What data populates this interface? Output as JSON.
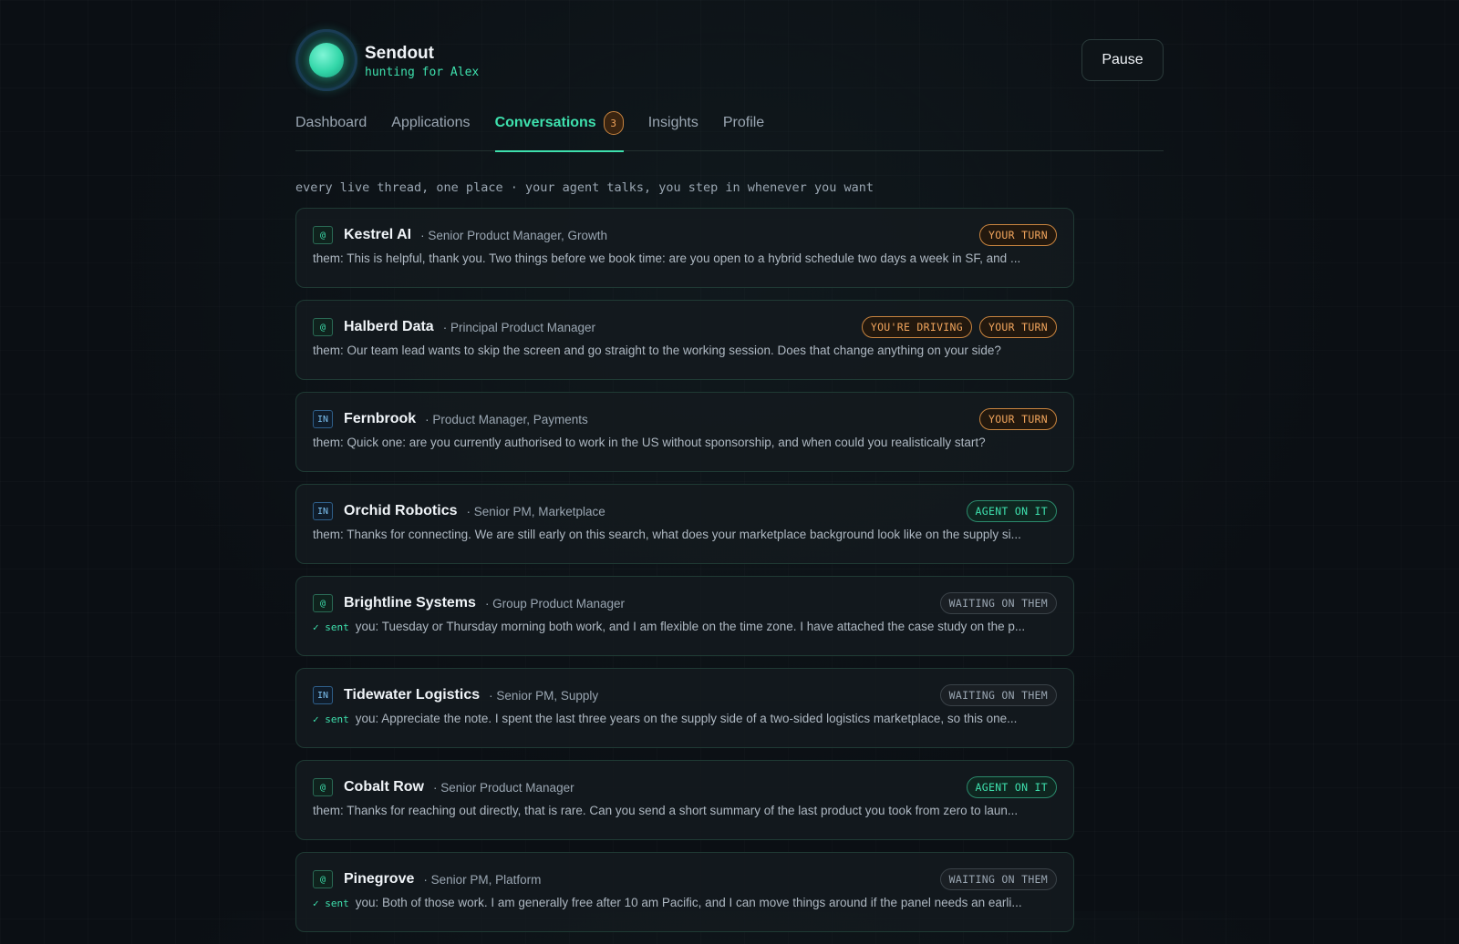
{
  "brand": {
    "name": "Sendout",
    "subtitle": "hunting for Alex"
  },
  "header": {
    "pause_label": "Pause"
  },
  "tabs": [
    {
      "label": "Dashboard"
    },
    {
      "label": "Applications"
    },
    {
      "label": "Conversations",
      "badge": "3",
      "active": true
    },
    {
      "label": "Insights"
    },
    {
      "label": "Profile"
    }
  ],
  "tagline": "every live thread, one place · your agent talks, you step in whenever you want",
  "conversations": [
    {
      "source": "@",
      "company": "Kestrel AI",
      "role": "· Senior Product Manager, Growth",
      "badges": [
        {
          "text": "YOUR TURN",
          "type": "yourturn"
        }
      ],
      "sent": "",
      "message": "them: This is helpful, thank you. Two things before we book time: are you open to a hybrid schedule two days a week in SF, and ..."
    },
    {
      "source": "@",
      "company": "Halberd Data",
      "role": "· Principal Product Manager",
      "badges": [
        {
          "text": "YOU'RE DRIVING",
          "type": "driving"
        },
        {
          "text": "YOUR TURN",
          "type": "yourturn"
        }
      ],
      "sent": "",
      "message": "them: Our team lead wants to skip the screen and go straight to the working session. Does that change anything on your side?"
    },
    {
      "source": "IN",
      "company": "Fernbrook",
      "role": "· Product Manager, Payments",
      "badges": [
        {
          "text": "YOUR TURN",
          "type": "yourturn"
        }
      ],
      "sent": "",
      "message": "them: Quick one: are you currently authorised to work in the US without sponsorship, and when could you realistically start?"
    },
    {
      "source": "IN",
      "company": "Orchid Robotics",
      "role": "· Senior PM, Marketplace",
      "badges": [
        {
          "text": "AGENT ON IT",
          "type": "agent"
        }
      ],
      "sent": "",
      "message": "them: Thanks for connecting. We are still early on this search, what does your marketplace background look like on the supply si..."
    },
    {
      "source": "@",
      "company": "Brightline Systems",
      "role": "· Group Product Manager",
      "badges": [
        {
          "text": "WAITING ON THEM",
          "type": "waiting"
        }
      ],
      "sent": "✓ sent",
      "message": "you: Tuesday or Thursday morning both work, and I am flexible on the time zone. I have attached the case study on the p..."
    },
    {
      "source": "IN",
      "company": "Tidewater Logistics",
      "role": "· Senior PM, Supply",
      "badges": [
        {
          "text": "WAITING ON THEM",
          "type": "waiting"
        }
      ],
      "sent": "✓ sent",
      "message": "you: Appreciate the note. I spent the last three years on the supply side of a two-sided logistics marketplace, so this one..."
    },
    {
      "source": "@",
      "company": "Cobalt Row",
      "role": "· Senior Product Manager",
      "badges": [
        {
          "text": "AGENT ON IT",
          "type": "agent"
        }
      ],
      "sent": "",
      "message": "them: Thanks for reaching out directly, that is rare. Can you send a short summary of the last product you took from zero to laun..."
    },
    {
      "source": "@",
      "company": "Pinegrove",
      "role": "· Senior PM, Platform",
      "badges": [
        {
          "text": "WAITING ON THEM",
          "type": "waiting"
        }
      ],
      "sent": "✓ sent",
      "message": "you: Both of those work. I am generally free after 10 am Pacific, and I can move things around if the panel needs an earli..."
    }
  ]
}
